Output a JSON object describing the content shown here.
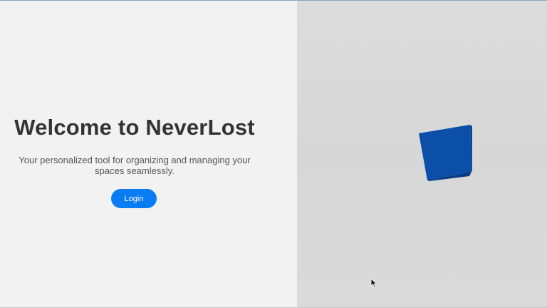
{
  "hero": {
    "title": "Welcome to NeverLost",
    "tagline": "Your personalized tool for organizing and managing your spaces seamlessly.",
    "login_label": "Login"
  },
  "scene": {
    "object": "cube",
    "cube_color": "#0c4fa8",
    "background_color": "#d9d9d9"
  },
  "icons": {
    "cursor": "mouse-pointer-icon"
  },
  "colors": {
    "accent": "#0a7cf3",
    "title_text": "#333333",
    "body_text": "#555555",
    "left_background": "#f2f2f2"
  }
}
